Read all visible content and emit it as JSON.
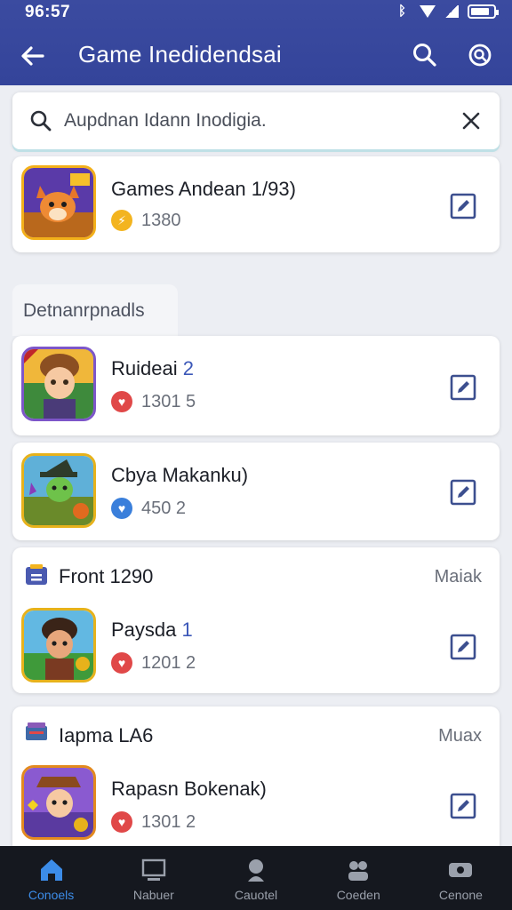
{
  "status_bar": {
    "time": "96:57"
  },
  "app_bar": {
    "title": "Game Inedidendsai",
    "icons": [
      "back-arrow-icon",
      "search-icon",
      "search-circle-icon"
    ]
  },
  "search": {
    "placeholder": "Aupdnan Idann Inodigia."
  },
  "featured": {
    "name": "Games Andean 1/93)",
    "stat": "1380",
    "badge_icon": "lightning-icon"
  },
  "section": {
    "label": "Detnanrpnadls"
  },
  "items": [
    {
      "name": "Ruideai",
      "name_num": "2",
      "stat": "1301 5",
      "badge_icon": "heart-icon"
    },
    {
      "name": "Cbya Makanku)",
      "name_num": "",
      "stat": "450  2",
      "badge_icon": "heart-icon"
    }
  ],
  "groups": [
    {
      "title": "Front 1290",
      "right": "Maiak",
      "item": {
        "name": "Paysda",
        "name_num": "1",
        "stat": "1201 2",
        "badge_icon": "heart-icon"
      }
    },
    {
      "title": "Iapma LA6",
      "right": "Muax",
      "item": {
        "name": "Rapasn Bokenak)",
        "name_num": "",
        "stat": "1301 2",
        "badge_icon": "heart-icon"
      }
    }
  ],
  "bottom_nav": [
    {
      "label": "Conoels",
      "icon": "home-icon",
      "active": true
    },
    {
      "label": "Nabuer",
      "icon": "monitor-icon",
      "active": false
    },
    {
      "label": "Cauotel",
      "icon": "person-icon",
      "active": false
    },
    {
      "label": "Coeden",
      "icon": "group-icon",
      "active": false
    },
    {
      "label": "Cenone",
      "icon": "gamepad-icon",
      "active": false
    }
  ],
  "colors": {
    "app_bar": "#3b4ba0",
    "accent": "#3c8ce8",
    "nav_bg": "#15181f",
    "edit_icon": "#3c4f8f"
  }
}
